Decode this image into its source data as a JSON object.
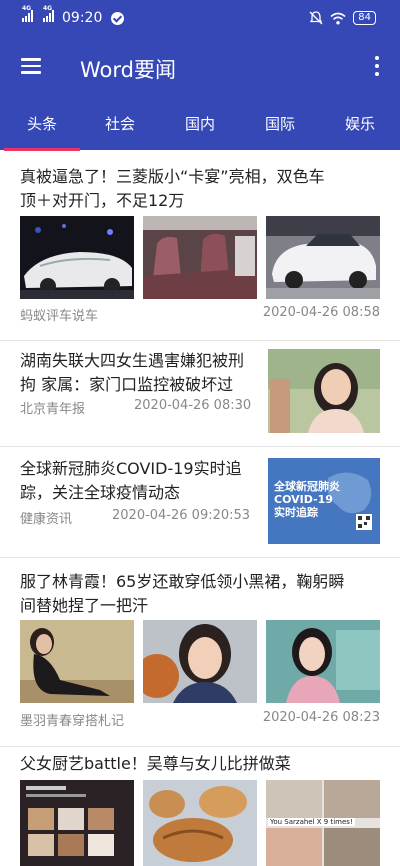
{
  "status_bar": {
    "net1": "4G",
    "net2": "4G",
    "time": "09:20",
    "battery": "84"
  },
  "app_bar": {
    "title": "Word要闻",
    "menu_icon": "hamburger-menu-icon",
    "more_icon": "more-vert-icon"
  },
  "tabs": [
    {
      "label": "头条",
      "selected": true
    },
    {
      "label": "社会"
    },
    {
      "label": "国内"
    },
    {
      "label": "国际"
    },
    {
      "label": "娱乐"
    }
  ],
  "articles": [
    {
      "title_line1": "真被逼急了！三菱版小“卡宴”亮相，双色车",
      "title_line2": "顶＋对开门，不足12万",
      "source": "蚂蚁评车说车",
      "time": "2020-04-26 08:58"
    },
    {
      "title_line1": "湖南失联大四女生遇害嫌犯被刑",
      "title_line2": "拘 家属：家门口监控被破坏过",
      "source": "北京青年报",
      "time": "2020-04-26 08:30"
    },
    {
      "title_line1": "全球新冠肺炎COVID-19实时追",
      "title_line2": "踪，关注全球疫情动态",
      "source": "健康资讯",
      "time": "2020-04-26 09:20:53",
      "image_text": [
        "全球新冠肺炎",
        "COVID-19",
        "实时追踪"
      ]
    },
    {
      "title_line1": "服了林青霞！65岁还敢穿低领小黑裙，鞠躬瞬",
      "title_line2": "间替她捏了一把汗",
      "source": "墨羽青春穿搭札记",
      "time": "2020-04-26 08:23"
    },
    {
      "title_line1": "父女厨艺battle！吴尊与女儿比拼做菜",
      "image_caption": "You Sarzahel X 9 times!"
    }
  ],
  "colors": {
    "primary": "#3548b5",
    "tab_indicator": "#e8336b",
    "meta_text": "#888888"
  }
}
